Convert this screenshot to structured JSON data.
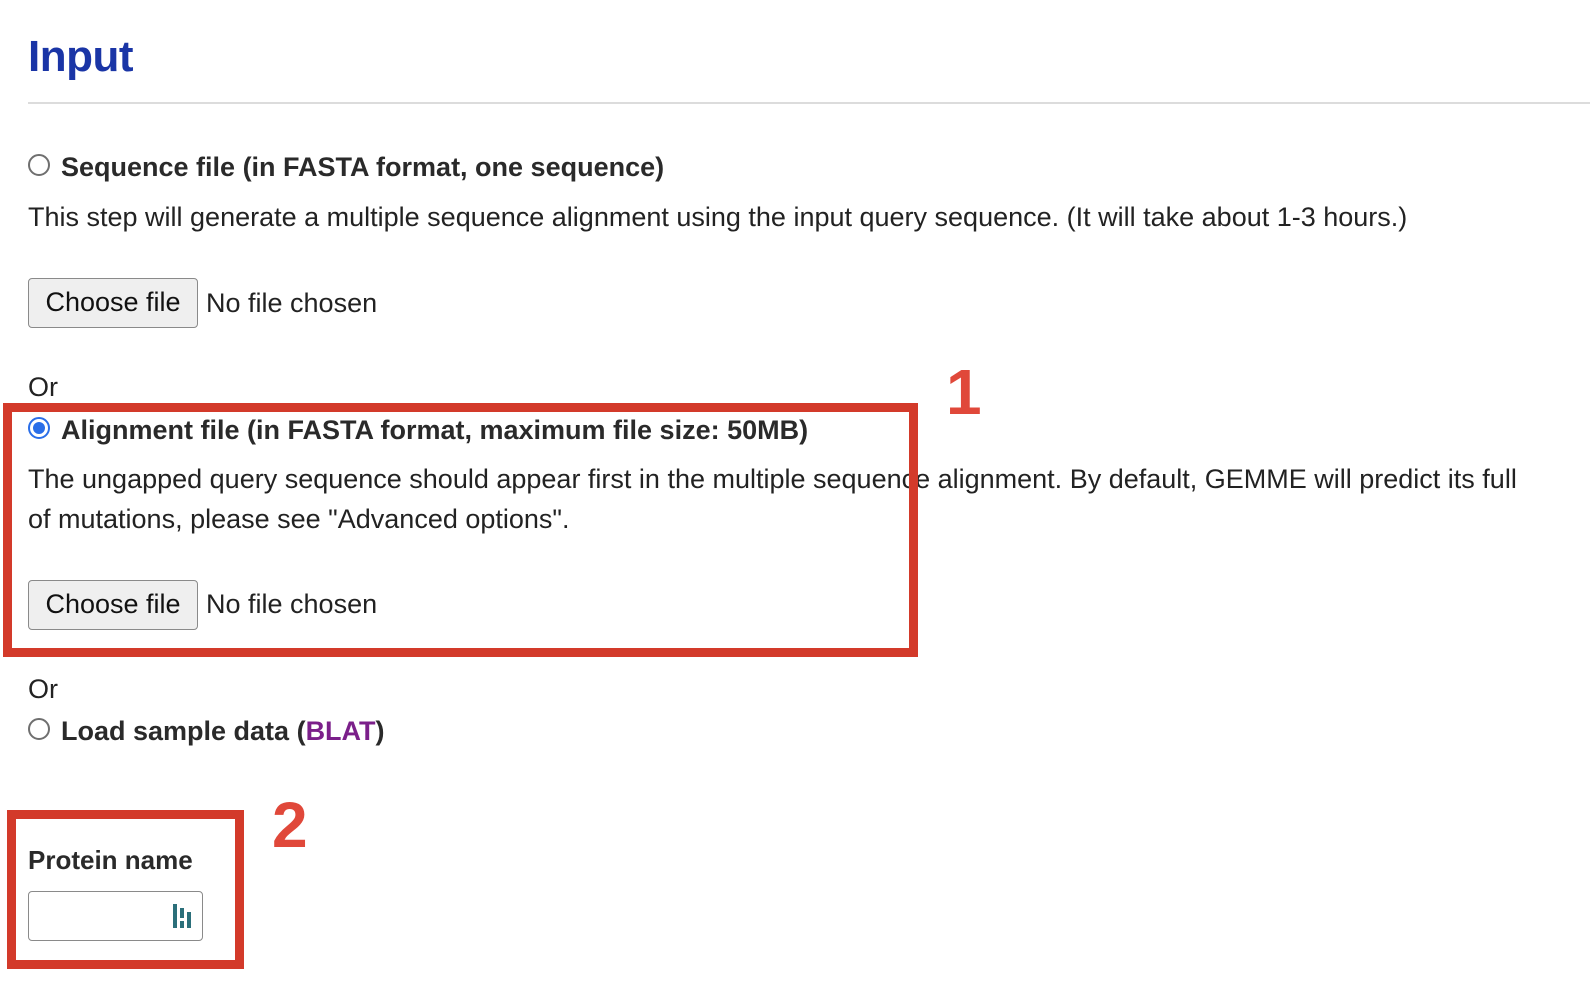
{
  "section": {
    "title": "Input"
  },
  "option_sequence": {
    "label": "Sequence file (in FASTA format, one sequence)",
    "description": "This step will generate a multiple sequence alignment using the input query sequence. (It will take about 1-3 hours.)",
    "choose_label": "Choose file",
    "file_status": "No file chosen",
    "selected": false
  },
  "or_1": "Or",
  "option_alignment": {
    "label": "Alignment file (in FASTA format, maximum file size: 50MB)",
    "description_line1": "The ungapped query sequence should appear first in the multiple sequence alignment. By default, GEMME will predict its full",
    "description_line2": "of mutations, please see \"Advanced options\".",
    "choose_label": "Choose file",
    "file_status": "No file chosen",
    "selected": true
  },
  "or_2": "Or",
  "option_sample": {
    "label_prefix": "Load sample data (",
    "link_text": "BLAT",
    "label_suffix": ")",
    "selected": false
  },
  "protein_name": {
    "label": "Protein name",
    "value": ""
  },
  "annotations": {
    "box1_number": "1",
    "box2_number": "2",
    "color": "#d33a2a"
  }
}
